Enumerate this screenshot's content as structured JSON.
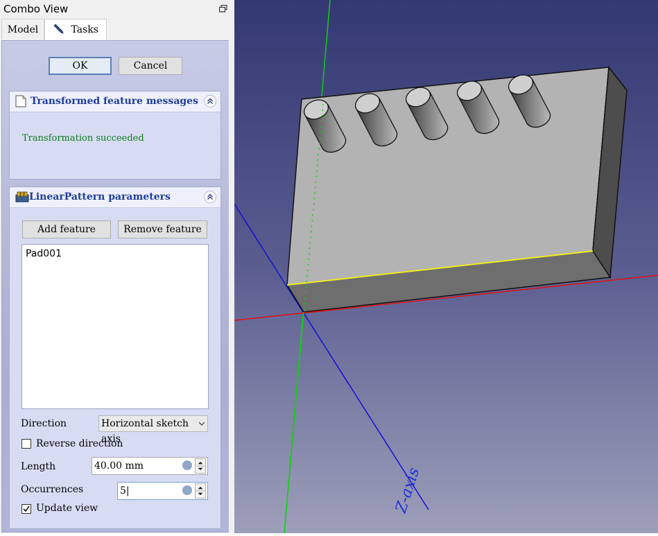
{
  "window": {
    "title": "Combo View"
  },
  "tabs": [
    {
      "label": "Model"
    },
    {
      "label": "Tasks"
    }
  ],
  "dialog": {
    "ok_label": "OK",
    "cancel_label": "Cancel"
  },
  "messages_panel": {
    "title": "Transformed feature messages",
    "message": "Transformation succeeded"
  },
  "params_panel": {
    "title": "LinearPattern parameters",
    "add_feature_label": "Add feature",
    "remove_feature_label": "Remove feature",
    "features": [
      "Pad001"
    ],
    "direction_label": "Direction",
    "direction_value": "Horizontal sketch axis",
    "reverse_label": "Reverse direction",
    "reverse_checked": false,
    "length_label": "Length",
    "length_value": "40.00 mm",
    "occurrences_label": "Occurrences",
    "occurrences_value": "5|",
    "update_label": "Update view",
    "update_checked": true
  },
  "viewport": {
    "axis_label": "Z-axis"
  },
  "colors": {
    "panel_title": "#1f3c9a",
    "success_text": "#0a7a1c",
    "x_axis": "#e01010",
    "y_axis": "#10d010",
    "z_axis": "#1010d8",
    "selected_edge": "#f0f020"
  }
}
